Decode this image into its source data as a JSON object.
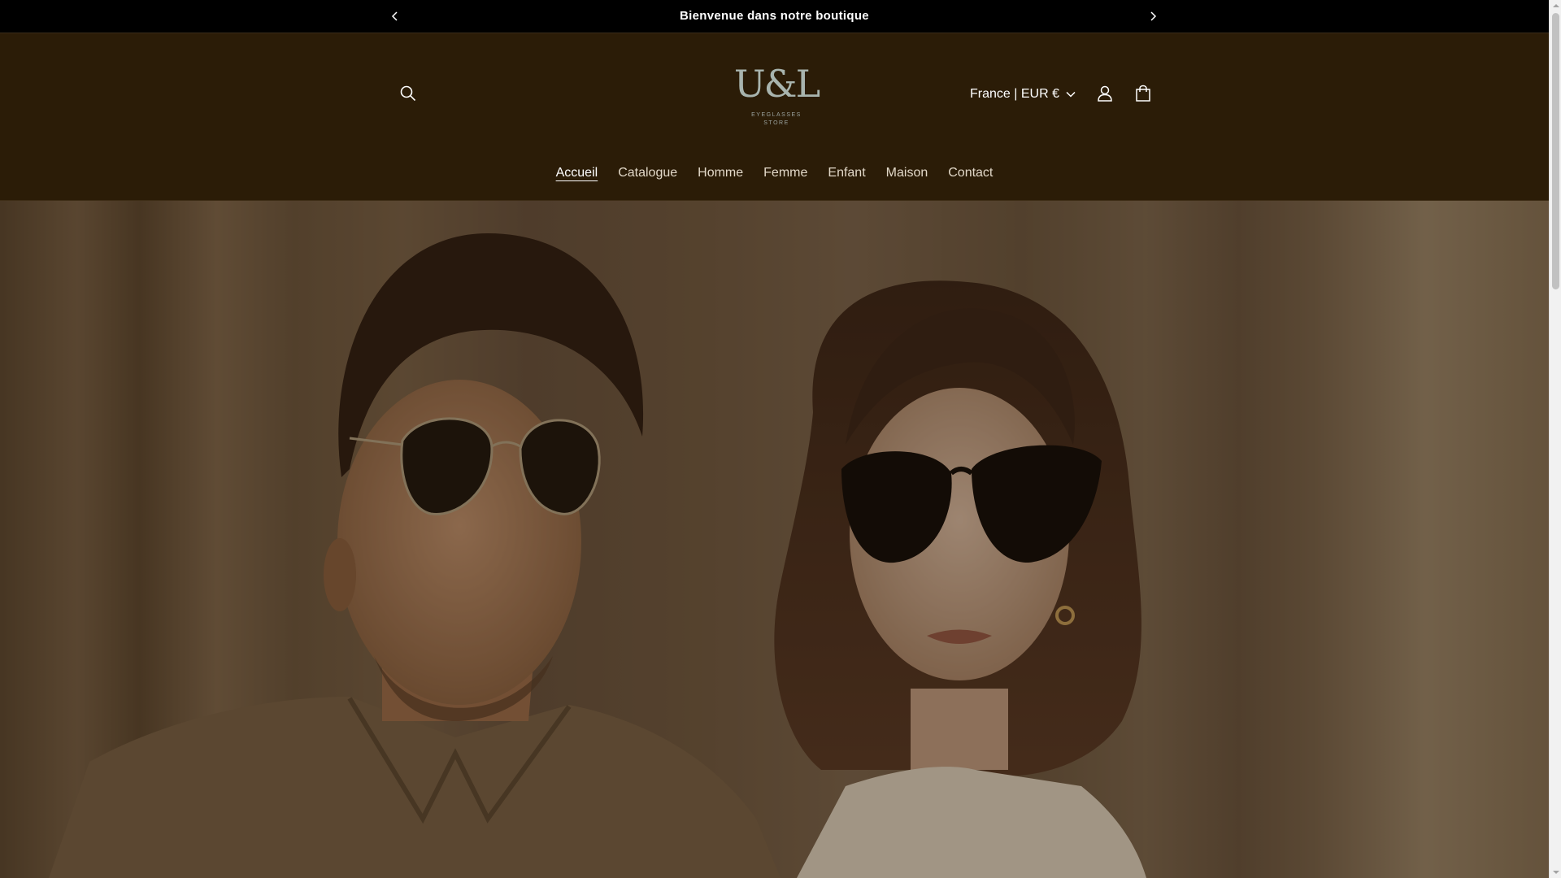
{
  "announcement": {
    "text": "Bienvenue dans notre boutique",
    "prev_icon": "chevron-left-icon",
    "next_icon": "chevron-right-icon"
  },
  "header": {
    "logo": {
      "mark": "U&L",
      "line1": "EYEGLASSES",
      "line2": "STORE"
    },
    "country_selector": "France | EUR €",
    "icons": {
      "search": "search-icon",
      "account": "account-icon",
      "cart": "cart-icon"
    }
  },
  "nav": {
    "items": [
      {
        "label": "Accueil",
        "active": true
      },
      {
        "label": "Catalogue"
      },
      {
        "label": "Homme"
      },
      {
        "label": "Femme"
      },
      {
        "label": "Enfant"
      },
      {
        "label": "Maison"
      },
      {
        "label": "Contact"
      }
    ]
  },
  "colors": {
    "announcement_bg": "#000000",
    "header_bg": "#2b1c07",
    "text": "#ffffff"
  }
}
